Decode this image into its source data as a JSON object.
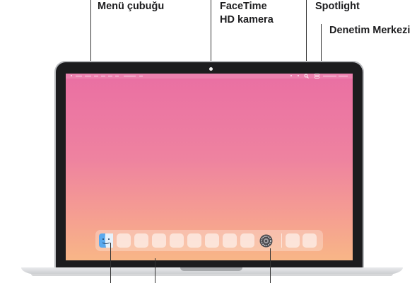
{
  "callouts": {
    "menu_bar": "Menü çubuğu",
    "camera_line1": "FaceTime",
    "camera_line2": "HD kamera",
    "spotlight": "Spotlight",
    "control_center": "Denetim Merkezi"
  },
  "colors": {
    "wallpaper_top": "#ea6fa3",
    "wallpaper_bottom": "#f8b687",
    "bezel": "#1c1c1e",
    "leader_lines": "#333333"
  },
  "icons": {
    "finder": "finder-icon",
    "system_settings": "system-settings-icon",
    "spotlight": "magnifier-icon",
    "control_center": "control-center-icon",
    "apple": "apple-icon"
  }
}
